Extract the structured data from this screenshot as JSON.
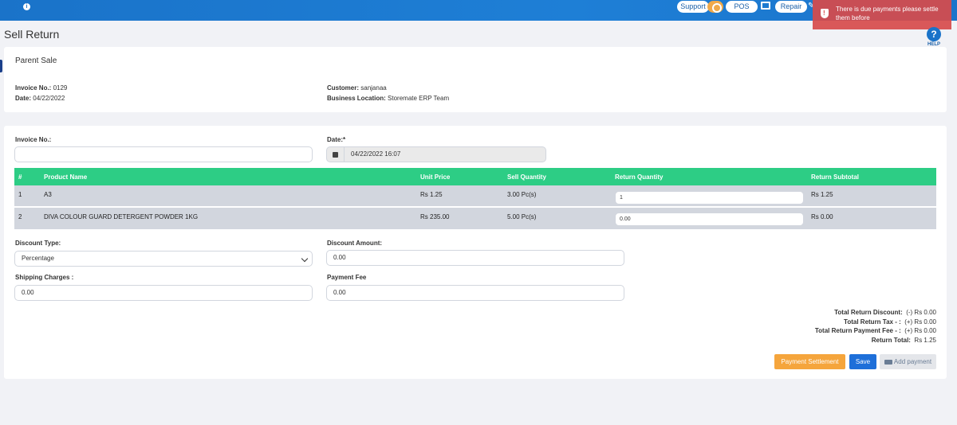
{
  "topbar": {
    "support_label": "Support",
    "pos_label": "POS",
    "repair_label": "Repair"
  },
  "toast": {
    "message": "There is due payments please settle them before"
  },
  "page": {
    "title": "Sell Return",
    "help_label": "HELP"
  },
  "parent_sale": {
    "heading": "Parent Sale",
    "invoice_label": "Invoice No.:",
    "invoice_value": "0129",
    "date_label": "Date:",
    "date_value": "04/22/2022",
    "customer_label": "Customer:",
    "customer_value": "sanjanaa",
    "location_label": "Business Location:",
    "location_value": "Storemate ERP Team"
  },
  "form": {
    "invoice_label": "Invoice No.:",
    "invoice_value": "",
    "date_label": "Date:*",
    "date_value": "04/22/2022 16:07",
    "discount_type_label": "Discount Type:",
    "discount_type_value": "Percentage",
    "discount_amount_label": "Discount Amount:",
    "discount_amount_value": "0.00",
    "shipping_label": "Shipping Charges :",
    "shipping_value": "0.00",
    "payment_fee_label": "Payment Fee",
    "payment_fee_value": "0.00"
  },
  "table": {
    "headers": [
      "#",
      "Product Name",
      "Unit Price",
      "Sell Quantity",
      "Return Quantity",
      "Return Subtotal"
    ],
    "rows": [
      {
        "num": "1",
        "product": "A3",
        "unit_price": "Rs 1.25",
        "sell_qty": "3.00 Pc(s)",
        "return_qty": "1",
        "subtotal": "Rs 1.25"
      },
      {
        "num": "2",
        "product": "DIVA COLOUR GUARD DETERGENT POWDER 1KG",
        "unit_price": "Rs 235.00",
        "sell_qty": "5.00 Pc(s)",
        "return_qty": "0.00",
        "subtotal": "Rs 0.00"
      }
    ]
  },
  "totals": {
    "discount_label": "Total Return Discount:",
    "discount_value": "(-) Rs 0.00",
    "tax_label": "Total Return Tax - :",
    "tax_value": "(+) Rs 0.00",
    "payment_fee_label": "Total Return Payment Fee - :",
    "payment_fee_value": "(+) Rs 0.00",
    "total_label": "Return Total:",
    "total_value": "Rs 1.25"
  },
  "buttons": {
    "payment_settlement": "Payment Settlement",
    "save": "Save",
    "add_payment": "Add payment"
  },
  "colors": {
    "topbar": "#1a73c9",
    "table_header": "#2dcd85",
    "settlement": "#f5a53c",
    "save": "#1e6fd9",
    "toast": "#d74b4b"
  }
}
